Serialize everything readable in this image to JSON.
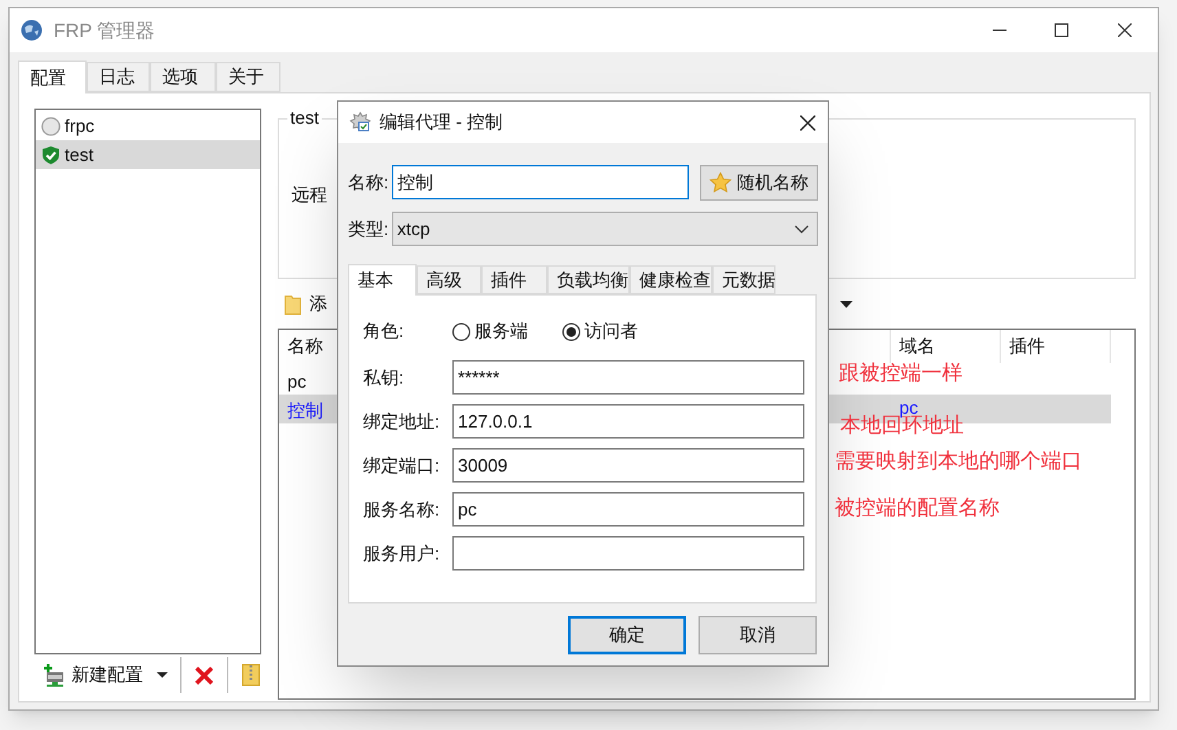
{
  "window": {
    "title": "FRP 管理器"
  },
  "tabs": [
    {
      "label": "配置",
      "selected": true
    },
    {
      "label": "日志",
      "selected": false
    },
    {
      "label": "选项",
      "selected": false
    },
    {
      "label": "关于",
      "selected": false
    }
  ],
  "configs": [
    {
      "name": "frpc",
      "kind": "stopped",
      "selected": false
    },
    {
      "name": "test",
      "kind": "running",
      "selected": true
    }
  ],
  "config_toolbar": {
    "new_button": "新建配置"
  },
  "group": {
    "title": "test",
    "labels": [
      "远程"
    ]
  },
  "proxy_toolbar": {
    "add_button": "添"
  },
  "proxy_table": {
    "columns": [
      "名称",
      "域名",
      "插件"
    ],
    "rows": [
      {
        "name": "pc",
        "selected": false
      },
      {
        "name": "控制",
        "domain": "pc",
        "selected": true
      }
    ]
  },
  "dialog": {
    "title": "编辑代理 - 控制",
    "name_label": "名称:",
    "name_value": "控制",
    "random_button": "随机名称",
    "type_label": "类型:",
    "type_value": "xtcp",
    "tabs": [
      {
        "label": "基本",
        "selected": true
      },
      {
        "label": "高级",
        "selected": false
      },
      {
        "label": "插件",
        "selected": false
      },
      {
        "label": "负载均衡",
        "selected": false
      },
      {
        "label": "健康检查",
        "selected": false
      },
      {
        "label": "元数据",
        "selected": false
      }
    ],
    "role": {
      "label": "角色:",
      "options": [
        {
          "label": "服务端",
          "selected": false
        },
        {
          "label": "访问者",
          "selected": true
        }
      ]
    },
    "fields": [
      {
        "label": "私钥:",
        "value": "******"
      },
      {
        "label": "绑定地址:",
        "value": "127.0.0.1"
      },
      {
        "label": "绑定端口:",
        "value": "30009"
      },
      {
        "label": "服务名称:",
        "value": "pc"
      },
      {
        "label": "服务用户:"
      }
    ],
    "buttons": [
      {
        "label": "确定",
        "default": true
      },
      {
        "label": "取消",
        "default": false
      }
    ]
  },
  "annotations": [
    "跟被控端一样",
    "本地回环地址",
    "需要映射到本地的哪个端口",
    "被控端的配置名称"
  ]
}
